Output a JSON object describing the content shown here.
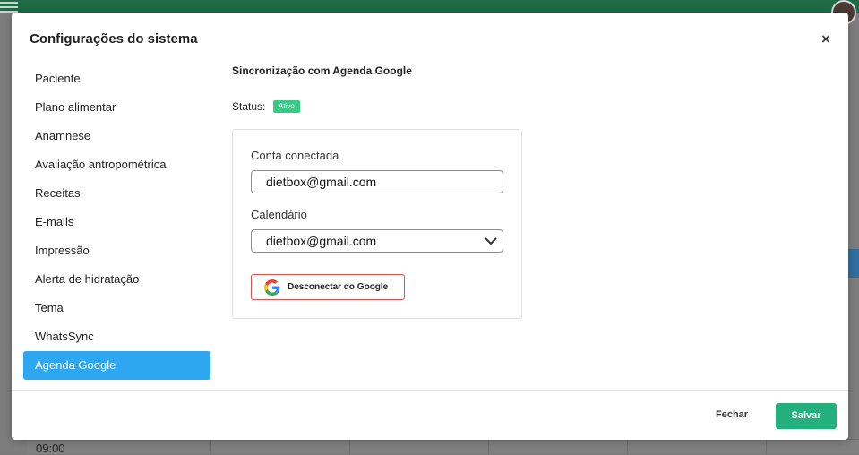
{
  "modal": {
    "title": "Configurações do sistema",
    "close_icon": "close-icon",
    "sidebar": {
      "items": [
        {
          "label": "Paciente"
        },
        {
          "label": "Plano alimentar"
        },
        {
          "label": "Anamnese"
        },
        {
          "label": "Avaliação antropométrica"
        },
        {
          "label": "Receitas"
        },
        {
          "label": "E-mails"
        },
        {
          "label": "Impressão"
        },
        {
          "label": "Alerta de hidratação"
        },
        {
          "label": "Tema"
        },
        {
          "label": "WhatsSync"
        },
        {
          "label": "Agenda Google",
          "active": true
        }
      ]
    },
    "section": {
      "title": "Sincronização com Agenda Google",
      "status_label": "Status:",
      "status_value": "Ativo",
      "account_label": "Conta conectada",
      "account_value": "dietbox@gmail.com",
      "calendar_label": "Calendário",
      "calendar_value": "dietbox@gmail.com",
      "disconnect_label": "Desconectar do Google"
    },
    "footer": {
      "close_label": "Fechar",
      "save_label": "Salvar"
    }
  },
  "background": {
    "time_label": "09:00"
  },
  "colors": {
    "accent_active": "#2ea6f0",
    "status_green": "#38c985",
    "save_green": "#23b07d",
    "topbar_green": "#1e6b45",
    "disconnect_border": "#d9534f"
  }
}
